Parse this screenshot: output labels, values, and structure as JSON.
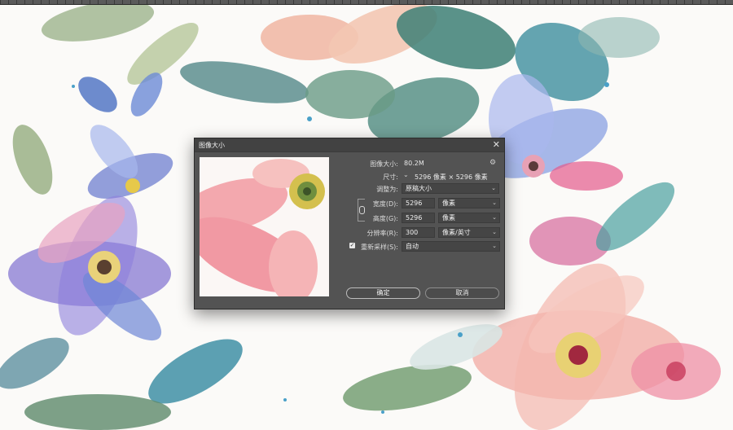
{
  "dialog": {
    "title": "图像大小",
    "image_size_label": "图像大小:",
    "image_size_value": "80.2M",
    "dimensions_label": "尺寸:",
    "dimensions_value": "5296 像素 × 5296 像素",
    "fit_to_label": "调整为:",
    "fit_to_value": "原稿大小",
    "width_label": "宽度(D):",
    "width_value": "5296",
    "width_unit": "像素",
    "height_label": "高度(G):",
    "height_value": "5296",
    "height_unit": "像素",
    "resolution_label": "分辨率(R):",
    "resolution_value": "300",
    "resolution_unit": "像素/英寸",
    "resample_label": "重新采样(S):",
    "resample_value": "自动",
    "resample_checked": true,
    "ok_label": "确定",
    "cancel_label": "取消"
  },
  "icons": {
    "close": "close-icon",
    "gear": "gear-icon",
    "link": "link-chain-icon",
    "dropdown": "chevron-down-icon",
    "checkbox": "checkmark-icon"
  },
  "colors": {
    "dialog_bg": "#535353",
    "titlebar_bg": "#424242",
    "field_bg": "#454545",
    "text": "#e6e6e6"
  }
}
